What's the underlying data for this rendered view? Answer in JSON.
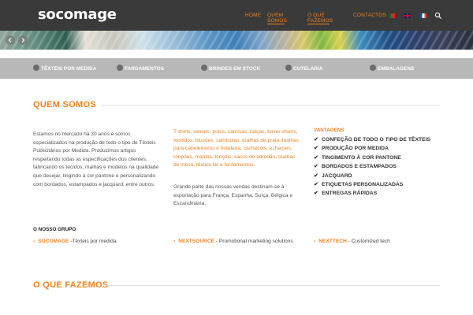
{
  "header": {
    "logo": "socomage",
    "nav": [
      {
        "label": "HOME"
      },
      {
        "label": "QUEM SOMOS"
      },
      {
        "label": "O QUE FAZEMOS"
      },
      {
        "label": "CONTACTOS"
      }
    ],
    "accent": "#f0821e",
    "background": "#3a3a3a"
  },
  "categories": [
    {
      "label": "TÊXTEIS POR MEDIDA"
    },
    {
      "label": "FARDAMENTOS"
    },
    {
      "label": "BRINDES EM STOCK"
    },
    {
      "label": "CUTELARIA"
    },
    {
      "label": "EMBALAGENS"
    }
  ],
  "quem_somos": {
    "title": "QUEM SOMOS",
    "col1": "Estamos no mercado há 30 anos e somos especializados na produção de todo o tipo de Têxteis Publicitários por Medida. Produzimos artigos respeitando todas as especificações dos clientes, fabricando os tecidos, malhas e modelos na qualidade que desejar, tingindo à cor pantone e personalizando com bordados, estampados e jacquard, entre outros.",
    "col2_orange": "T-shirts, sweats, polos, camisas, calças, boxer-shorts, vestidos, blusões, camisolas, toalhas de praia, toalhas para cabeleireiros e hotelaria, cachecóis, écharpes, roupões, mantas, lençóis, sacos de edredão, toalhas de mesa, têxteis lar e fardamentos.",
    "col2_text": "Grande parte das nossas vendas destinam-se à exportação para França, Espanha, Suíça, Bélgica e Escandinávia.",
    "vantagens_title": "VANTAGENS",
    "vantagens": [
      "CONFEÇÃO DE TODO O TIPO DE TÊXTEIS",
      "PRODUÇÃO POR MEDIDA",
      "TINGIMENTO À COR PANTONE",
      "BORDADOS E ESTAMPADOS",
      "JACQUARD",
      "ETIQUETAS PERSONALIZADAS",
      "ENTREGAS RÁPIDAS"
    ]
  },
  "grupo": {
    "title": "O NOSSO GRUPO",
    "items": [
      {
        "name": "SOCOMAGE",
        "sep": " -",
        "desc": "Têxteis por medida"
      },
      {
        "name": "NEXTSOURCE",
        "sep": " - ",
        "desc": "Promotional marketing solutions"
      },
      {
        "name": "NEXTTECH",
        "sep": " - ",
        "desc": "Customized tech"
      }
    ]
  },
  "o_que_fazemos": {
    "title": "O QUE FAZEMOS"
  }
}
